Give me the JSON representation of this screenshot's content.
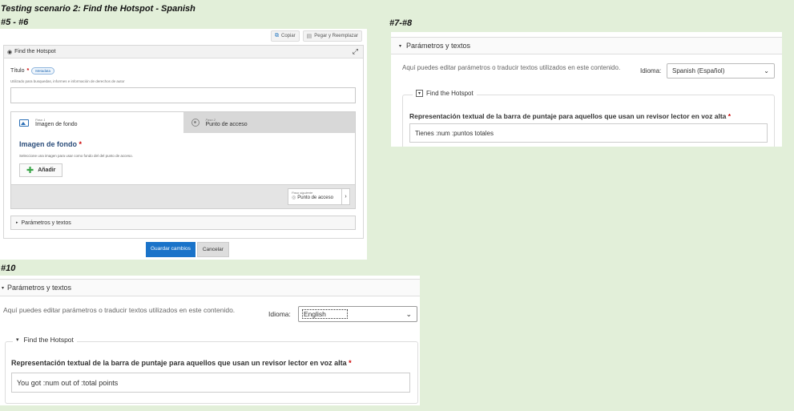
{
  "captions": {
    "main": "Testing scenario 2: Find the Hotspot - Spanish",
    "p1": "#5 - #6",
    "p2": "#7-#8",
    "p3": "#10"
  },
  "p1": {
    "copy_label": "Copiar",
    "paste_label": "Pegar y Reemplazar",
    "editor_title": "Find the Hotspot",
    "titulo_label": "Título",
    "metadata_badge": "Metadata",
    "titulo_desc": "Utilizado para busquedas, informes e información de derechos de autor",
    "step1_small": "Paso 1",
    "step1_label": "Imagen de fondo",
    "step2_small": "Paso 2",
    "step2_label": "Punto de acceso",
    "section_title": "Imagen de fondo",
    "section_desc": "Seleccione una imagen para usar como fondo del del punto de acceso.",
    "add_label": "Añadir",
    "next_small": "Paso siguiente",
    "next_label": "Punto de acceso",
    "params_label": "Parámetros y textos",
    "save_label": "Guardar cambios",
    "cancel_label": "Cancelar"
  },
  "p2": {
    "section": "Parámetros y textos",
    "desc": "Aquí puedes editar parámetros o traducir textos utilizados en este contenido.",
    "lang_label": "Idioma:",
    "lang_value": "Spanish (Español)",
    "group_title": "Find the Hotspot",
    "field_label": "Representación textual de la barra de puntaje para aquellos que usan un revisor lector en voz alta",
    "field_value": "Tienes :num :puntos totales"
  },
  "p3": {
    "section": "Parámetros y textos",
    "desc": "Aquí puedes editar parámetros o traducir textos utilizados en este contenido.",
    "lang_label": "Idioma:",
    "lang_value": "English",
    "group_title": "Find the Hotspot",
    "field_label": "Representación textual de la barra de puntaje para aquellos que usan un revisor lector en voz alta",
    "field_value": "You got :num out of :total points"
  }
}
